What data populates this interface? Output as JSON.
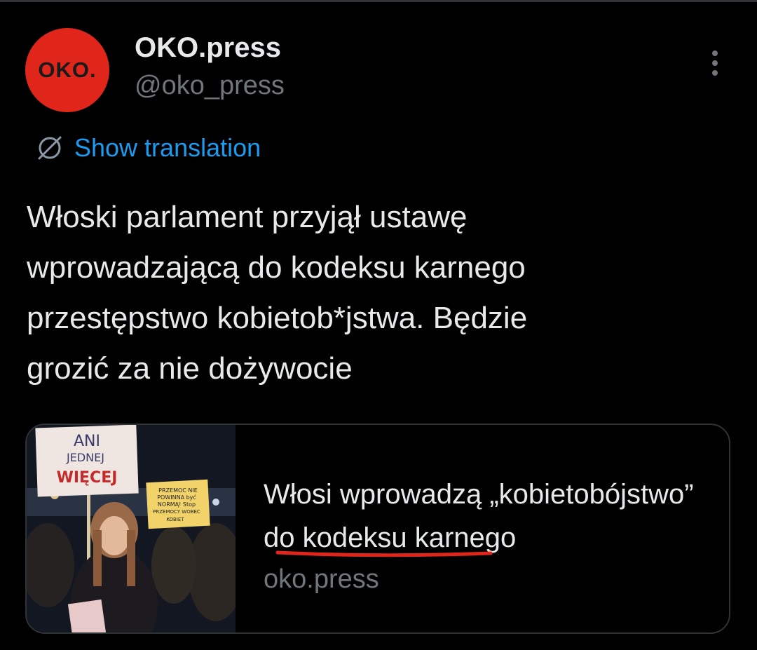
{
  "colors": {
    "accent": "#1d9bf0",
    "avatar_bg": "#e0261b",
    "underline": "#e0261b"
  },
  "tweet": {
    "author": {
      "name": "OKO.press",
      "handle": "@oko_press",
      "avatar_text": "OKO."
    },
    "translate_label": "Show translation",
    "text": "Włoski parlament przyjął ustawę\nwprowadzającą do kodeksu karnego\nprzestępstwo kobietob*jstwa. Będzie\ngrozić za nie dożywocie",
    "card": {
      "title": "Włosi wprowadzą „kobietobójstwo” do kodeksu karnego",
      "domain": "oko.press",
      "image": {
        "sign_1": [
          "ANI",
          "JEDNEJ",
          "WIĘCEJ"
        ],
        "sign_2": [
          "PRZEMOC NIE",
          "POWINNA być",
          "NORMĄ! Stop",
          "PRZEMOCY WOBEC",
          "KOBIET"
        ]
      }
    }
  },
  "icons": {
    "more": "more-vertical-icon",
    "translate": "globe-slash-icon"
  }
}
